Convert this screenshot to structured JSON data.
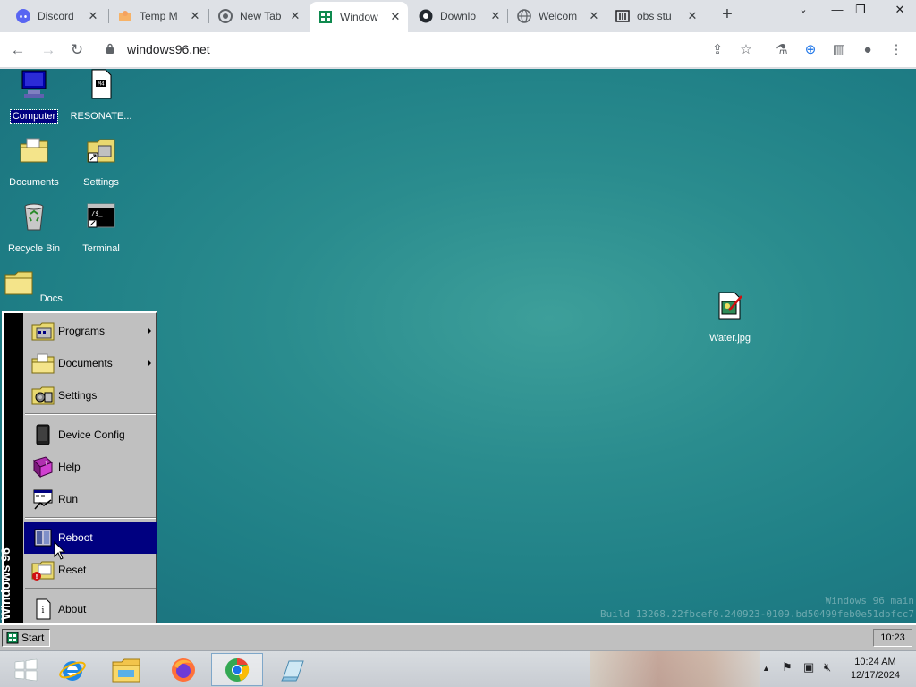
{
  "browser": {
    "tabs": [
      {
        "label": "Discord",
        "icon": "discord-icon",
        "active": false
      },
      {
        "label": "Temp M",
        "icon": "temp-mail-icon",
        "active": false
      },
      {
        "label": "New Tab",
        "icon": "chrome-icon",
        "active": false
      },
      {
        "label": "Window",
        "icon": "windows96-icon",
        "active": true
      },
      {
        "label": "Downlo",
        "icon": "github-icon",
        "active": false
      },
      {
        "label": "Welcom",
        "icon": "globe-icon",
        "active": false
      },
      {
        "label": "obs stu",
        "icon": "archive-icon",
        "active": false
      }
    ],
    "url": "windows96.net"
  },
  "desktop": {
    "icons": [
      {
        "label": "Computer",
        "icon": "computer-icon"
      },
      {
        "label": "RESONATE...",
        "icon": "text-file-icon"
      },
      {
        "label": "Documents",
        "icon": "documents-folder-icon"
      },
      {
        "label": "Settings",
        "icon": "settings-icon"
      },
      {
        "label": "Recycle Bin",
        "icon": "recycle-bin-icon"
      },
      {
        "label": "Terminal",
        "icon": "terminal-icon"
      },
      {
        "label": "Docs",
        "icon": "folder-icon"
      },
      {
        "label": "Water.jpg",
        "icon": "image-file-icon"
      }
    ],
    "watermark": {
      "line1": "Windows 96 main",
      "line2": "Build 13268.22fbcef0.240923-0109.bd50499feb0e51dbfcc7"
    }
  },
  "start_menu": {
    "brand": "Windows 96",
    "items": [
      {
        "label": "Programs",
        "icon": "programs-icon",
        "submenu": true
      },
      {
        "label": "Documents",
        "icon": "documents-icon",
        "submenu": true
      },
      {
        "label": "Settings",
        "icon": "settings-icon",
        "submenu": false
      },
      {
        "label": "Device Config",
        "icon": "device-icon",
        "submenu": false
      },
      {
        "label": "Help",
        "icon": "help-book-icon",
        "submenu": false
      },
      {
        "label": "Run",
        "icon": "run-icon",
        "submenu": false
      },
      {
        "label": "Reboot",
        "icon": "reboot-icon",
        "submenu": false,
        "highlighted": true
      },
      {
        "label": "Reset",
        "icon": "reset-icon",
        "submenu": false
      },
      {
        "label": "About",
        "icon": "about-icon",
        "submenu": false
      }
    ]
  },
  "win96_taskbar": {
    "start_label": "Start",
    "clock": "10:23"
  },
  "host_taskbar": {
    "apps": [
      "internet-explorer-icon",
      "file-explorer-icon",
      "firefox-icon",
      "chrome-like-icon",
      "notepad-icon"
    ],
    "time": "10:24 AM",
    "date": "12/17/2024"
  },
  "colors": {
    "menu_highlight": "#000080",
    "desktop_teal": "#2a8c8e",
    "win_gray": "#c0c0c0"
  }
}
